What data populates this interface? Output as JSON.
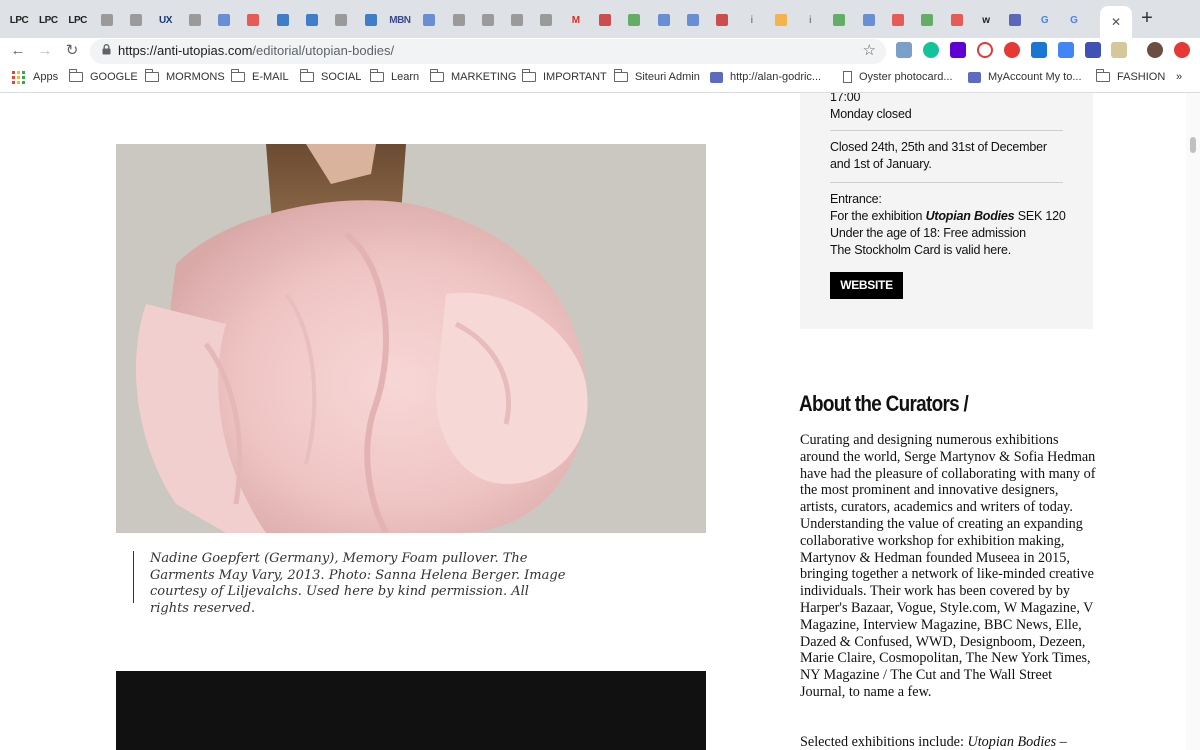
{
  "browser": {
    "tabs": [
      {
        "label": "LPC"
      },
      {
        "label": "LPC"
      },
      {
        "label": "LPC"
      },
      {
        "label": ""
      },
      {
        "label": ""
      },
      {
        "label": "UX"
      },
      {
        "label": ""
      },
      {
        "label": ""
      },
      {
        "label": ""
      },
      {
        "label": ""
      },
      {
        "label": ""
      },
      {
        "label": ""
      },
      {
        "label": ""
      },
      {
        "label": "MBN"
      },
      {
        "label": ""
      },
      {
        "label": ""
      },
      {
        "label": ""
      },
      {
        "label": ""
      },
      {
        "label": ""
      },
      {
        "label": "M"
      },
      {
        "label": ""
      },
      {
        "label": ""
      },
      {
        "label": ""
      },
      {
        "label": ""
      },
      {
        "label": ""
      },
      {
        "label": "i"
      },
      {
        "label": ""
      },
      {
        "label": "i"
      },
      {
        "label": ""
      },
      {
        "label": ""
      },
      {
        "label": ""
      },
      {
        "label": ""
      },
      {
        "label": ""
      },
      {
        "label": "w"
      },
      {
        "label": ""
      },
      {
        "label": "G"
      },
      {
        "label": "G"
      }
    ],
    "active_tab_close": "✕",
    "new_tab": "+",
    "url_host": "https://anti-utopias.com",
    "url_path": "/editorial/utopian-bodies/",
    "bookmarks": [
      {
        "label": "Apps",
        "icon": "apps-grid-icon"
      },
      {
        "label": "GOOGLE",
        "icon": "folder-icon"
      },
      {
        "label": "MORMONS",
        "icon": "folder-icon"
      },
      {
        "label": "E-MAIL",
        "icon": "folder-icon"
      },
      {
        "label": "SOCIAL",
        "icon": "folder-icon"
      },
      {
        "label": "Learn",
        "icon": "folder-icon"
      },
      {
        "label": "MARKETING",
        "icon": "folder-icon"
      },
      {
        "label": "IMPORTANT",
        "icon": "folder-icon"
      },
      {
        "label": "Siteuri Admin",
        "icon": "folder-icon"
      },
      {
        "label": "http://alan-godric...",
        "icon": "site-icon"
      },
      {
        "label": "Oyster photocard...",
        "icon": "doc-icon"
      },
      {
        "label": "MyAccount My to...",
        "icon": "site-icon"
      },
      {
        "label": "FASHION",
        "icon": "folder-icon"
      }
    ],
    "more_bookmarks": "»"
  },
  "page": {
    "caption": "Nadine Goepfert (Germany), Memory Foam pullover. The Garments May Vary, 2013. Photo: Sanna Helena Berger. Image courtesy of Liljevalchs. Used here by kind permission. All rights reserved.",
    "info": {
      "hours_tail": "17:00",
      "monday": "Monday closed",
      "closed_dates": "Closed 24th, 25th and 31st of December and 1st of January.",
      "entrance_title": "Entrance:",
      "entrance_prefix": "For the exhibition ",
      "entrance_exhibition": "Utopian Bodies",
      "entrance_price": " SEK 120",
      "under18": "Under the age of 18: Free admission",
      "stockholm_card": "The Stockholm Card is valid here.",
      "website_button": "WEBSITE"
    },
    "about_title": "About the Curators /",
    "about_body": "Curating and designing numerous exhibitions around the world, Serge Martynov & Sofia Hedman have had the pleasure of collaborating with many of the most prominent and innovative designers, artists, curators, academics and writers of today. Understanding the value of creating an expanding collaborative workshop for exhibition making, Martynov & Hedman founded Museea in 2015, bringing together a network of like-minded creative individuals. Their work has been covered by by Harper's Bazaar, Vogue, Style.com, W Magazine, V Magazine, Interview Magazine, BBC News, Elle, Dazed & Confused, WWD, Designboom, Dezeen, Marie Claire, Cosmopolitan, The New York Times, NY Magazine / The Cut and The Wall Street Journal, to name a few.",
    "selected_prefix": "Selected exhibitions include: ",
    "selected_italic": "Utopian Bodies",
    "selected_suffix": " –"
  }
}
